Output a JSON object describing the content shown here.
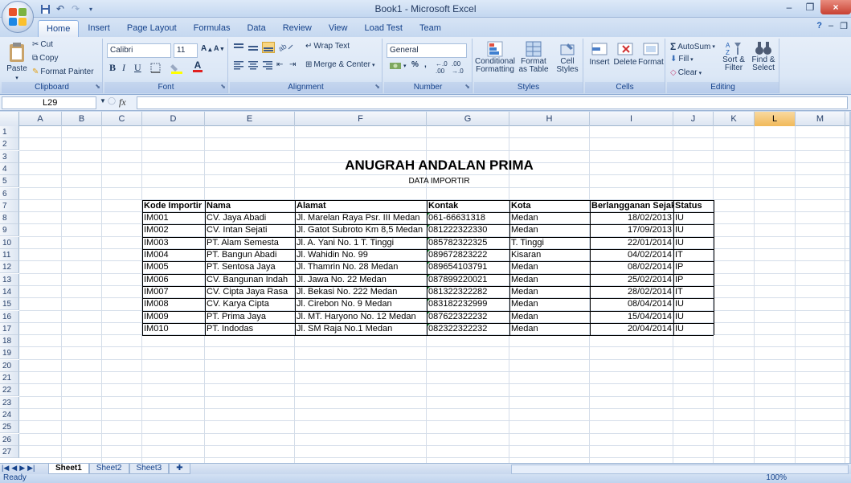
{
  "window": {
    "title": "Book1 - Microsoft Excel"
  },
  "ribbon_tabs": [
    "Home",
    "Insert",
    "Page Layout",
    "Formulas",
    "Data",
    "Review",
    "View",
    "Load Test",
    "Team"
  ],
  "clipboard": {
    "paste": "Paste",
    "cut": "Cut",
    "copy": "Copy",
    "format_painter": "Format Painter",
    "label": "Clipboard"
  },
  "font": {
    "name": "Calibri",
    "size": "11",
    "label": "Font"
  },
  "alignment": {
    "wrap_text": "Wrap Text",
    "merge_center": "Merge & Center",
    "label": "Alignment"
  },
  "number": {
    "format": "General",
    "percent": "%",
    "comma": ",",
    "label": "Number"
  },
  "styles": {
    "conditional": "Conditional",
    "formatting": "Formatting",
    "format_as": "Format",
    "as_table": "as Table",
    "cell": "Cell",
    "styles_btn": "Styles",
    "label": "Styles"
  },
  "cells": {
    "insert": "Insert",
    "delete": "Delete",
    "format": "Format",
    "label": "Cells"
  },
  "editing": {
    "autosum": "AutoSum",
    "fill": "Fill",
    "clear": "Clear",
    "sort": "Sort &",
    "filter": "Filter",
    "find": "Find &",
    "select": "Select",
    "label": "Editing"
  },
  "namebox": "L29",
  "fx": "fx",
  "columns": [
    "A",
    "B",
    "C",
    "D",
    "E",
    "F",
    "G",
    "H",
    "I",
    "J",
    "K",
    "L",
    "M"
  ],
  "rows": [
    "1",
    "2",
    "3",
    "4",
    "5",
    "6",
    "7",
    "8",
    "9",
    "10",
    "11",
    "12",
    "13",
    "14",
    "15",
    "16",
    "17",
    "18",
    "19",
    "20",
    "21",
    "22",
    "23",
    "24",
    "25",
    "26",
    "27"
  ],
  "sheet": {
    "title": "ANUGRAH ANDALAN PRIMA",
    "subtitle": "DATA IMPORTIR",
    "headers": [
      "Kode Importir",
      "Nama",
      "Alamat",
      "Kontak",
      "Kota",
      "Berlangganan Sejak",
      "Status"
    ],
    "data": [
      [
        "IM001",
        "CV. Jaya Abadi",
        "Jl. Marelan Raya Psr. III Medan",
        "061-66631318",
        "Medan",
        "18/02/2013",
        "IU"
      ],
      [
        "IM002",
        "CV. Intan Sejati",
        "Jl. Gatot Subroto Km 8,5 Medan",
        "081222322330",
        "Medan",
        "17/09/2013",
        "IU"
      ],
      [
        "IM003",
        "PT. Alam Semesta",
        "Jl. A. Yani No. 1 T. Tinggi",
        "085782322325",
        "T. Tinggi",
        "22/01/2014",
        "IU"
      ],
      [
        "IM004",
        "PT. Bangun Abadi",
        "Jl. Wahidin No. 99",
        "089672823222",
        "Kisaran",
        "04/02/2014",
        "IT"
      ],
      [
        "IM005",
        "PT. Sentosa Jaya",
        "Jl. Thamrin No. 28 Medan",
        "089654103791",
        "Medan",
        "08/02/2014",
        "IP"
      ],
      [
        "IM006",
        "CV. Bangunan Indah",
        "Jl. Jawa No. 22 Medan",
        "087899220021",
        "Medan",
        "25/02/2014",
        "IP"
      ],
      [
        "IM007",
        "CV. Cipta Jaya Rasa",
        "Jl. Bekasi No. 222 Medan",
        "081322322282",
        "Medan",
        "28/02/2014",
        "IT"
      ],
      [
        "IM008",
        "CV. Karya Cipta",
        "Jl. Cirebon No. 9 Medan",
        "083182232999",
        "Medan",
        "08/04/2014",
        "IU"
      ],
      [
        "IM009",
        "PT. Prima Jaya",
        "Jl. MT. Haryono No. 12 Medan",
        "087622322232",
        "Medan",
        "15/04/2014",
        "IU"
      ],
      [
        "IM010",
        "PT. Indodas",
        "Jl. SM Raja No.1 Medan",
        "082322322232",
        "Medan",
        "20/04/2014",
        "IU"
      ]
    ]
  },
  "sheet_tabs": [
    "Sheet1",
    "Sheet2",
    "Sheet3"
  ],
  "status": {
    "ready": "Ready",
    "zoom": "100%"
  }
}
